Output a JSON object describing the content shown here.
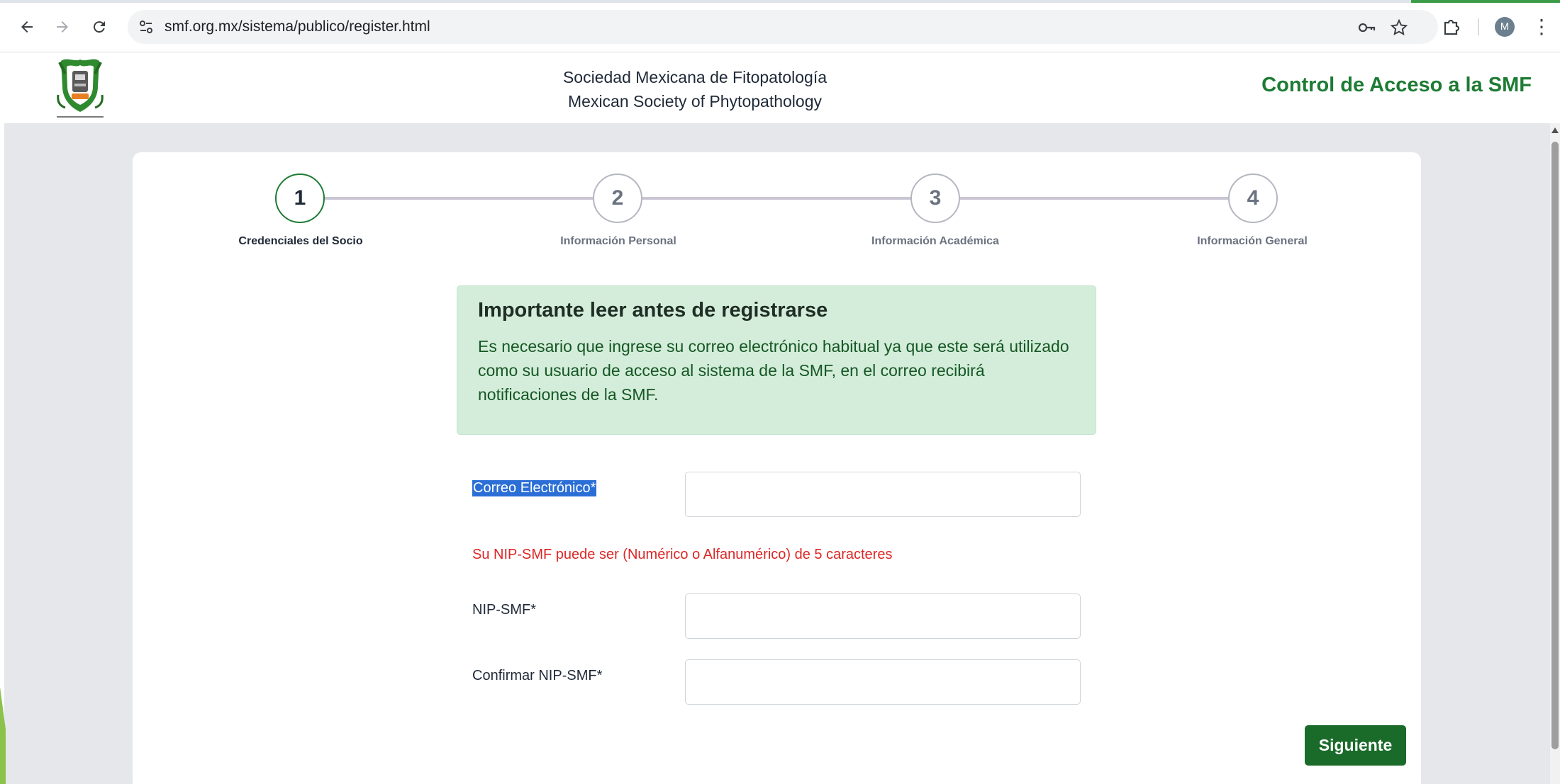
{
  "browser": {
    "url": "smf.org.mx/sistema/publico/register.html",
    "profile_initial": "M",
    "icons": [
      "back-icon",
      "forward-icon",
      "reload-icon",
      "site-info-icon",
      "password-key-icon",
      "bookmark-star-icon",
      "extensions-icon",
      "menu-icon"
    ]
  },
  "header": {
    "org_name_es": "Sociedad Mexicana de Fitopatología",
    "org_name_en": "Mexican Society of Phytopathology",
    "access_title": "Control de Acceso a la SMF"
  },
  "stepper": {
    "steps": [
      {
        "number": "1",
        "label": "Credenciales del Socio",
        "active": true
      },
      {
        "number": "2",
        "label": "Información Personal",
        "active": false
      },
      {
        "number": "3",
        "label": "Información Académica",
        "active": false
      },
      {
        "number": "4",
        "label": "Información General",
        "active": false
      }
    ]
  },
  "notice": {
    "title": "Importante leer antes de registrarse",
    "body": "Es necesario que ingrese su correo electrónico habitual ya que este será utilizado como su usuario de acceso al sistema de la SMF, en el correo recibirá notificaciones de la SMF."
  },
  "form": {
    "email_label": "Correo Electrónico*",
    "email_value": "",
    "nip_hint": "Su NIP-SMF puede ser (Numérico o Alfanumérico) de 5 caracteres",
    "nip_label": "NIP-SMF*",
    "nip_value": "",
    "confirm_nip_label": "Confirmar NIP-SMF*",
    "confirm_nip_value": "",
    "next_button": "Siguiente"
  },
  "colors": {
    "brand_green": "#1e7b34",
    "button_green": "#1a6b2a",
    "alert_bg": "#d4edda",
    "hint_red": "#dc2626",
    "selection_blue": "#2b6fd6"
  }
}
